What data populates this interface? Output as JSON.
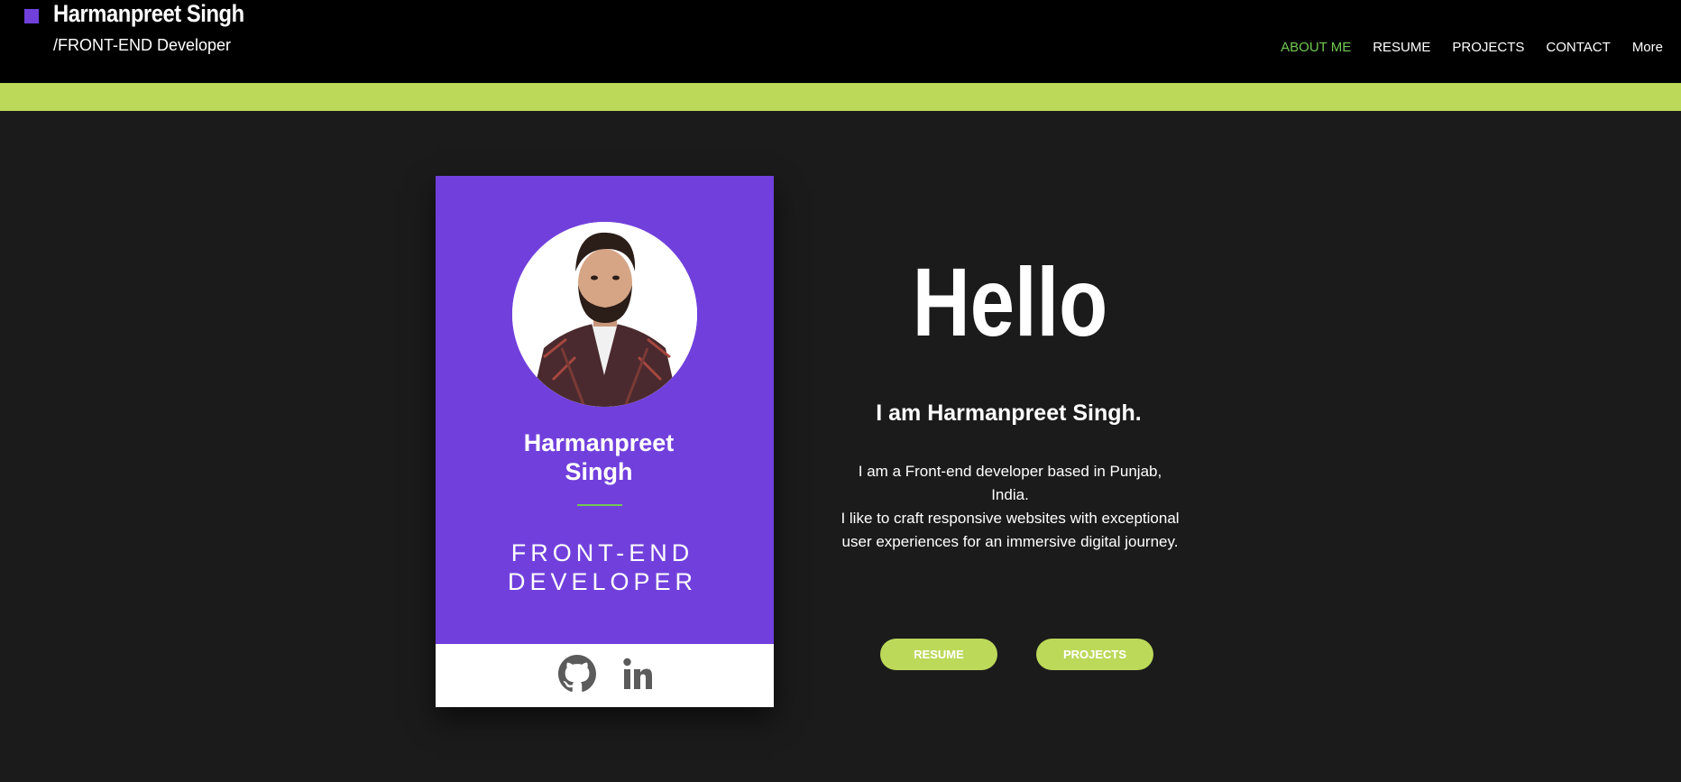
{
  "header": {
    "name": "Harmanpreet Singh",
    "subtitle": "/FRONT-END Developer",
    "nav": [
      {
        "label": "ABOUT ME",
        "active": true
      },
      {
        "label": "RESUME",
        "active": false
      },
      {
        "label": "PROJECTS",
        "active": false
      },
      {
        "label": "CONTACT",
        "active": false
      },
      {
        "label": "More",
        "active": false
      }
    ]
  },
  "card": {
    "name_line1": "Harmanpreet",
    "name_line2": "Singh",
    "role_line1": "FRONT-END",
    "role_line2": "DEVELOPER",
    "social": [
      "github-icon",
      "linkedin-icon"
    ]
  },
  "hero": {
    "greeting": "Hello",
    "intro": "I am Harmanpreet Singh.",
    "bio_line1": "I am a Front-end developer based in Punjab,",
    "bio_line2": "India.",
    "bio_line3": "I like to craft responsive websites with exceptional",
    "bio_line4": "user experiences for an immersive digital journey.",
    "btn_resume": "RESUME",
    "btn_projects": "PROJECTS"
  },
  "colors": {
    "accent_purple": "#7140dc",
    "accent_green": "#bcd95a",
    "nav_active": "#72c852",
    "background": "#1b1b1b"
  }
}
